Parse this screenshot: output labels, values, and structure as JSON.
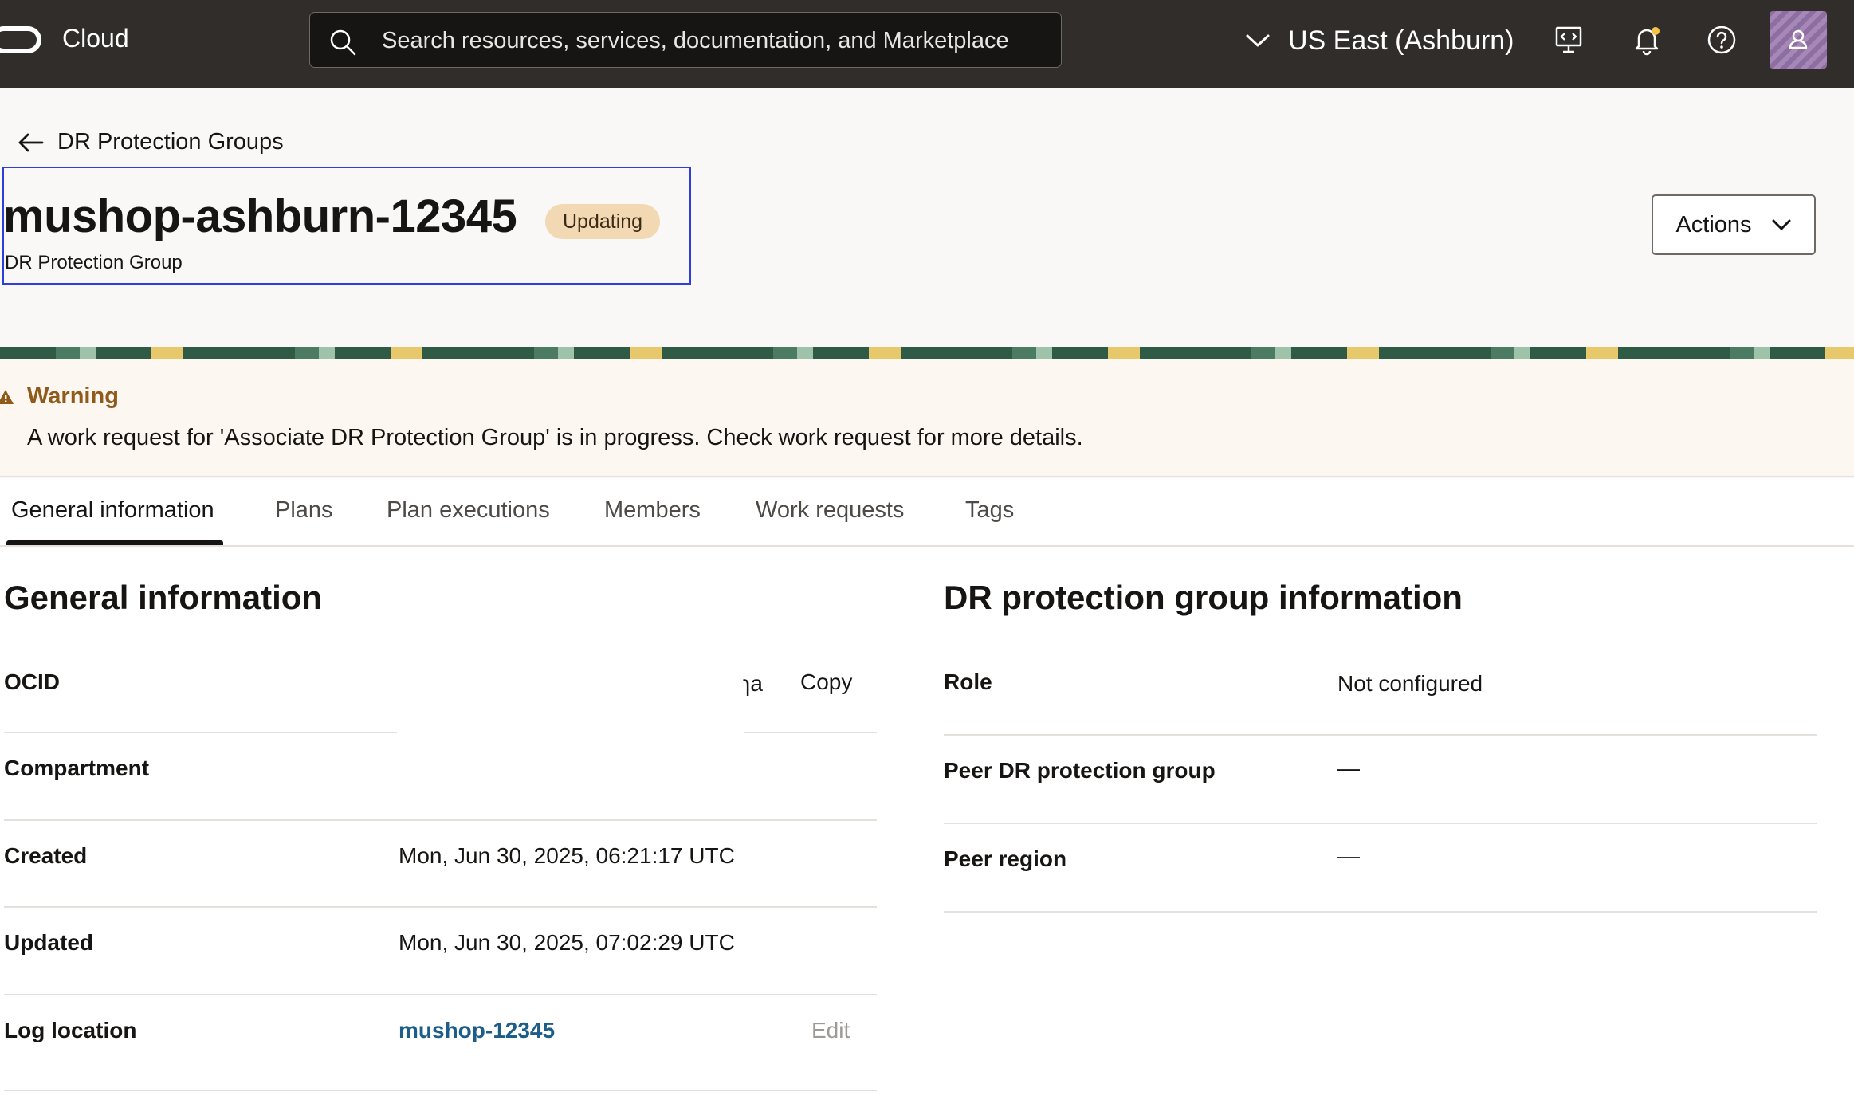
{
  "topbar": {
    "brand": "Cloud",
    "search_placeholder": "Search resources, services, documentation, and Marketplace",
    "region": "US East (Ashburn)"
  },
  "header": {
    "back_label": "DR Protection Groups",
    "title": "mushop-ashburn-12345",
    "status": "Updating",
    "subtitle": "DR Protection Group",
    "actions_label": "Actions"
  },
  "warning": {
    "title": "Warning",
    "message": "A work request for 'Associate DR Protection Group' is in progress. Check work request for more details."
  },
  "tabs": [
    {
      "label": "General information",
      "active": true
    },
    {
      "label": "Plans",
      "active": false
    },
    {
      "label": "Plan executions",
      "active": false
    },
    {
      "label": "Members",
      "active": false
    },
    {
      "label": "Work requests",
      "active": false
    },
    {
      "label": "Tags",
      "active": false
    }
  ],
  "general": {
    "title": "General information",
    "rows": [
      {
        "label": "OCID",
        "value": "ɿa",
        "action": "Copy"
      },
      {
        "label": "Compartment",
        "value": ""
      },
      {
        "label": "Created",
        "value": "Mon, Jun 30, 2025, 06:21:17 UTC"
      },
      {
        "label": "Updated",
        "value": "Mon, Jun 30, 2025, 07:02:29 UTC"
      },
      {
        "label": "Log location",
        "value": "mushop-12345",
        "action": "Edit"
      }
    ]
  },
  "dr_info": {
    "title": "DR protection group information",
    "rows": [
      {
        "label": "Role",
        "value": "Not configured"
      },
      {
        "label": "Peer DR protection group",
        "value": "—"
      },
      {
        "label": "Peer region",
        "value": "—"
      }
    ]
  },
  "colors": {
    "topbar": "#312d2a",
    "badge_bg": "#f2d8b3",
    "warning_title": "#8f5a1a",
    "link": "#1d5d8a",
    "focus_outline": "#2d3ed9"
  }
}
